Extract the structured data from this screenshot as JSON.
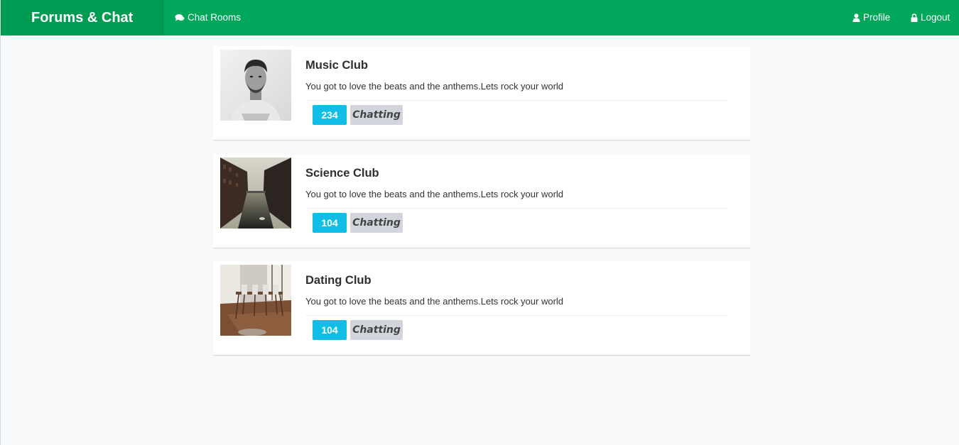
{
  "navbar": {
    "brand": "Forums & Chat",
    "chat_rooms_label": "Chat Rooms",
    "profile_label": "Profile",
    "logout_label": "Logout",
    "background_color": "#00a659"
  },
  "rooms": [
    {
      "title": "Music Club",
      "description": "You got to love the beats and the anthems.Lets rock your world",
      "count": "234",
      "status": "Chatting"
    },
    {
      "title": "Science Club",
      "description": "You got to love the beats and the anthems.Lets rock your world",
      "count": "104",
      "status": "Chatting"
    },
    {
      "title": "Dating Club",
      "description": "You got to love the beats and the anthems.Lets rock your world",
      "count": "104",
      "status": "Chatting"
    }
  ],
  "colors": {
    "count_badge": "#10bde6",
    "status_badge": "#d2d6dc"
  }
}
